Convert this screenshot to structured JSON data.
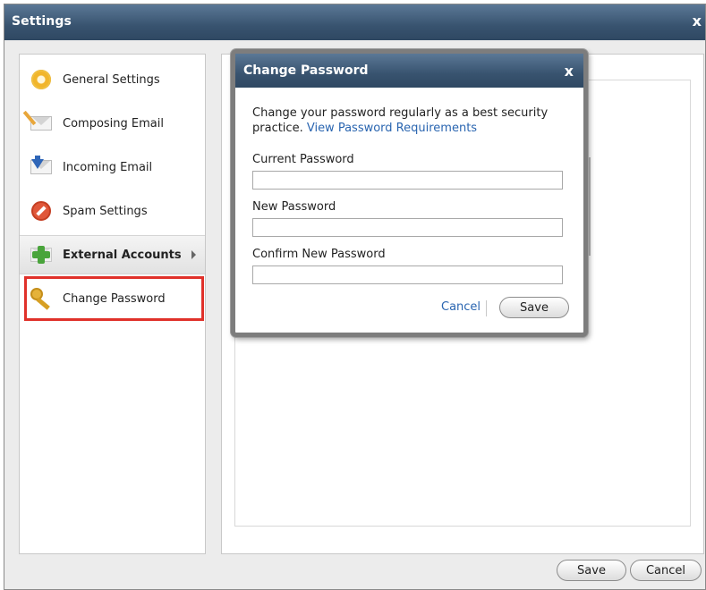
{
  "window": {
    "title": "Settings",
    "close_glyph": "x"
  },
  "sidebar": {
    "items": [
      {
        "label": "General Settings",
        "icon": "gear-icon"
      },
      {
        "label": "Composing Email",
        "icon": "compose-email-icon"
      },
      {
        "label": "Incoming Email",
        "icon": "incoming-email-icon"
      },
      {
        "label": "Spam Settings",
        "icon": "spam-icon"
      },
      {
        "label": "External Accounts",
        "icon": "add-account-icon"
      },
      {
        "label": "Change Password",
        "icon": "key-icon"
      }
    ],
    "highlighted": "Change Password",
    "highlight_color": "#e0312a"
  },
  "footer": {
    "save_label": "Save",
    "cancel_label": "Cancel"
  },
  "modal": {
    "title": "Change Password",
    "close_glyph": "x",
    "intro_text": "Change your password regularly as a best security practice.",
    "intro_link": "View Password Requirements",
    "fields": [
      {
        "label": "Current Password",
        "value": ""
      },
      {
        "label": "New Password",
        "value": ""
      },
      {
        "label": "Confirm New Password",
        "value": ""
      }
    ],
    "cancel_label": "Cancel",
    "save_label": "Save"
  },
  "colors": {
    "titlebar": "#38536f",
    "link": "#2a65b0",
    "highlight": "#e0312a"
  }
}
